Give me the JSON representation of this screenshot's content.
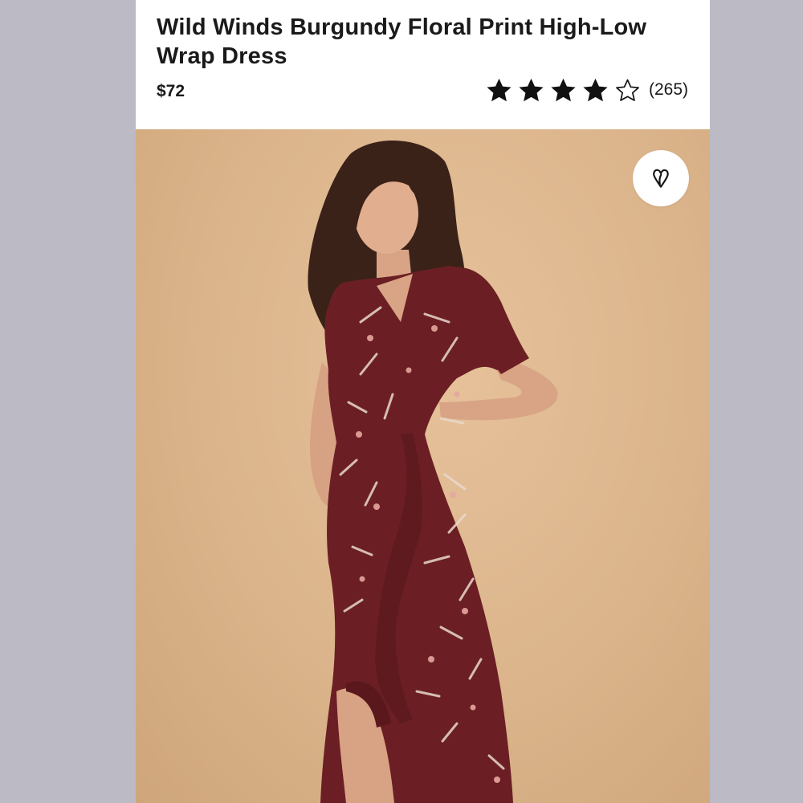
{
  "product": {
    "title": "Wild Winds Burgundy Floral Print High-Low Wrap Dress",
    "price": "$72",
    "rating": {
      "stars_filled": 4,
      "stars_total": 5,
      "review_count": "(265)"
    }
  },
  "image": {
    "subject": "model-wearing-dress",
    "background_color": "#dbb48b",
    "dress_color": "#6b1f24"
  },
  "actions": {
    "favorite_icon": "heart-icon"
  },
  "colors": {
    "page_bg": "#bcbac4",
    "card_bg": "#ffffff",
    "text": "#1a1a1a"
  }
}
